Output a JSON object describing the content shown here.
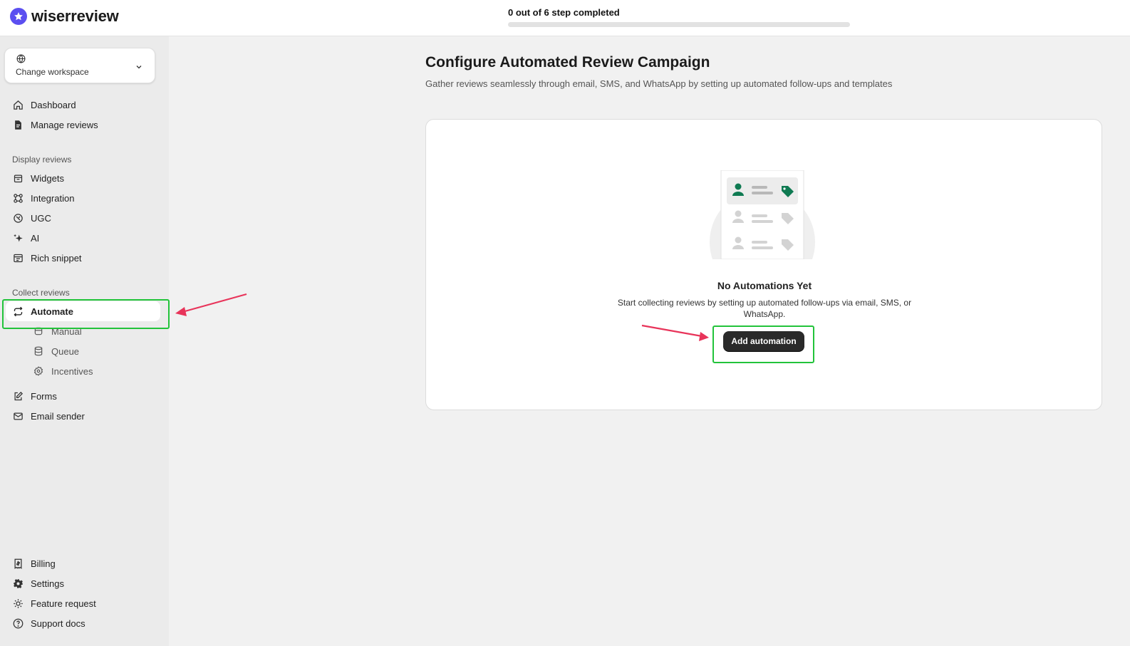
{
  "app": {
    "name": "wiserreview"
  },
  "progress": {
    "label": "0 out of 6 step completed",
    "completed": 0,
    "total": 6
  },
  "workspace": {
    "label": "Change workspace"
  },
  "nav": {
    "dashboard": "Dashboard",
    "manage_reviews": "Manage reviews",
    "display_section": "Display reviews",
    "widgets": "Widgets",
    "integration": "Integration",
    "ugc": "UGC",
    "ai": "AI",
    "rich_snippet": "Rich snippet",
    "collect_section": "Collect reviews",
    "automate": "Automate",
    "manual": "Manual",
    "queue": "Queue",
    "incentives": "Incentives",
    "forms": "Forms",
    "email_sender": "Email sender",
    "billing": "Billing",
    "settings": "Settings",
    "feature_request": "Feature request",
    "support_docs": "Support docs"
  },
  "main": {
    "title": "Configure Automated Review Campaign",
    "subtitle": "Gather reviews seamlessly through email, SMS, and WhatsApp by setting up automated follow-ups and templates",
    "empty_title": "No Automations Yet",
    "empty_text": "Start collecting reviews by setting up automated follow-ups via email, SMS, or WhatsApp.",
    "add_button": "Add automation"
  },
  "colors": {
    "brand": "#5b4ff0",
    "highlight": "#22c33a",
    "arrow": "#e8345a",
    "accent_green": "#0f7a52"
  }
}
